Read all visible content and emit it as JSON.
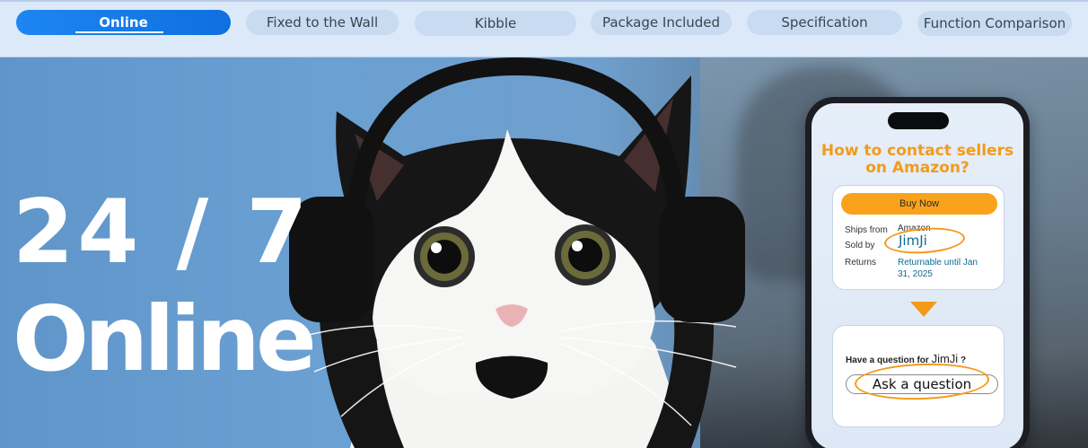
{
  "tabs": [
    {
      "label": "Online",
      "active": true
    },
    {
      "label": "Fixed to the Wall",
      "active": false
    },
    {
      "label": "Kibble",
      "active": false
    },
    {
      "label": "Package Included",
      "active": false
    },
    {
      "label": "Specification",
      "active": false
    },
    {
      "label": "Function Comparison",
      "active": false
    }
  ],
  "banner": {
    "headline_line1": "24 / 7",
    "headline_line2": "Online"
  },
  "phone": {
    "title": "How to contact sellers on Amazon?",
    "buy_now": "Buy Now",
    "ships_from_label": "Ships from",
    "ships_from_value": "Amazon",
    "sold_by_label": "Sold by",
    "sold_by_value": "JimJi",
    "returns_label": "Returns",
    "returns_value": "Returnable until Jan 31, 2025",
    "question_prefix": "Have a question for",
    "question_name": "JimJi",
    "question_suffix": "?",
    "ask_button": "Ask a question"
  },
  "colors": {
    "accent_orange": "#f39a1b",
    "active_tab_blue": "#1d86f2",
    "tab_bg": "#c9dbf0",
    "seller_teal": "#0a6c91"
  }
}
